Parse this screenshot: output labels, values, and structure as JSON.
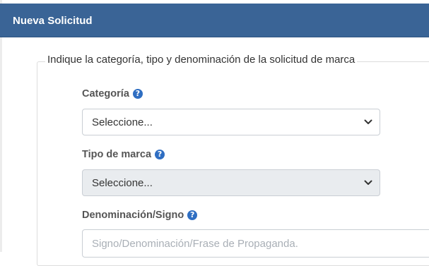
{
  "header": {
    "title": "Nueva Solicitud"
  },
  "form": {
    "legend": "Indique la categoría, tipo y denominación de la solicitud de marca",
    "categoria": {
      "label": "Categoría",
      "value": "Seleccione..."
    },
    "tipo_marca": {
      "label": "Tipo de marca",
      "value": "Seleccione..."
    },
    "denominacion": {
      "label": "Denominación/Signo",
      "placeholder": "Signo/Denominación/Frase de Propaganda."
    }
  },
  "icons": {
    "help": "question-circle-icon",
    "dropdown": "chevron-down-icon"
  },
  "colors": {
    "header_bg": "#3a6496",
    "help_icon": "#2f6ec2",
    "disabled_bg": "#e9ecef"
  }
}
